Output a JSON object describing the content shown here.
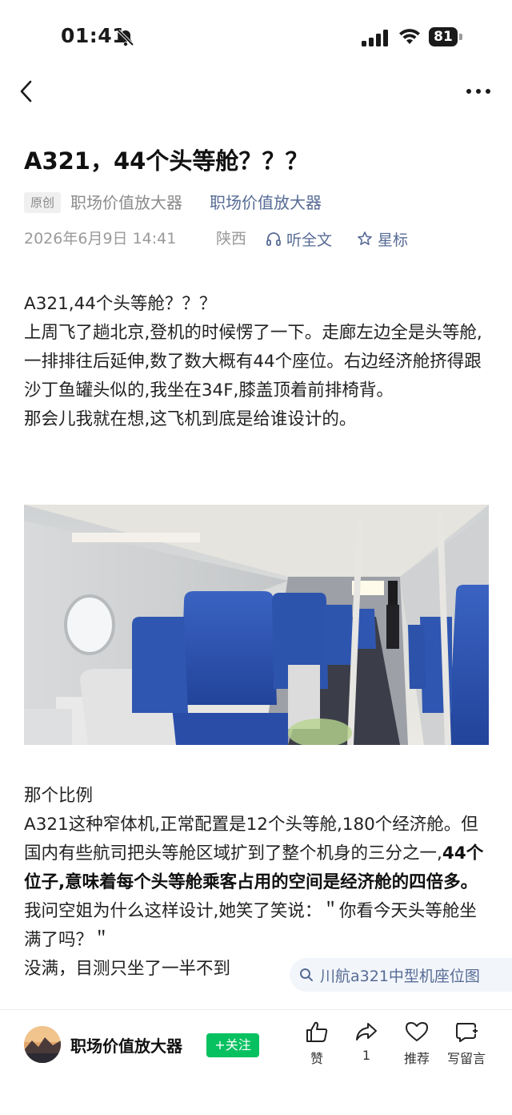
{
  "status_bar": {
    "time": "01:41",
    "battery": "81"
  },
  "article": {
    "title": "A321，44个头等舱？？？",
    "badge": "原创",
    "author_plain": "职场价值放大器",
    "author_link": "职场价值放大器",
    "date": "2026年6月9日 14:41",
    "location": "陕西",
    "listen_label": "听全文",
    "star_label": "星标"
  },
  "content": {
    "p1_lines": [
      "A321,44个头等舱？？？",
      "上周飞了趟北京,登机的时候愣了一下。走廊左边全是头等舱,一排排往后延伸,数了数大概有44个座位。右边经济舱挤得跟沙丁鱼罐头似的,我坐在34F,膝盖顶着前排椅背。",
      "那会儿我就在想,这飞机到底是给谁设计的。"
    ],
    "p2_heading": "那个比例",
    "p2_text_a": "A321这种窄体机,正常配置是12个头等舱,180个经济舱。但国内有些航司把头等舱区域扩到了整个机身的三分之一,",
    "p2_text_bold": "44个位子,意味着每个头等舱乘客占用的空间是经济舱的四倍多。",
    "p2_text_c": "我问空姐为什么这样设计,她笑了笑说：＂你看今天头等舱坐满了吗？＂",
    "p2_text_d": "没满，目测只坐了一半不到"
  },
  "search_chip": {
    "query": "川航a321中型机座位图"
  },
  "bottom_bar": {
    "author": "职场价值放大器",
    "follow_label": "+关注",
    "like_label": "赞",
    "share_count": "1",
    "recommend_label": "推荐",
    "comment_label": "写留言"
  },
  "colors": {
    "link": "#576b95",
    "follow": "#07c160",
    "seat_blue": "#2f56b0"
  }
}
